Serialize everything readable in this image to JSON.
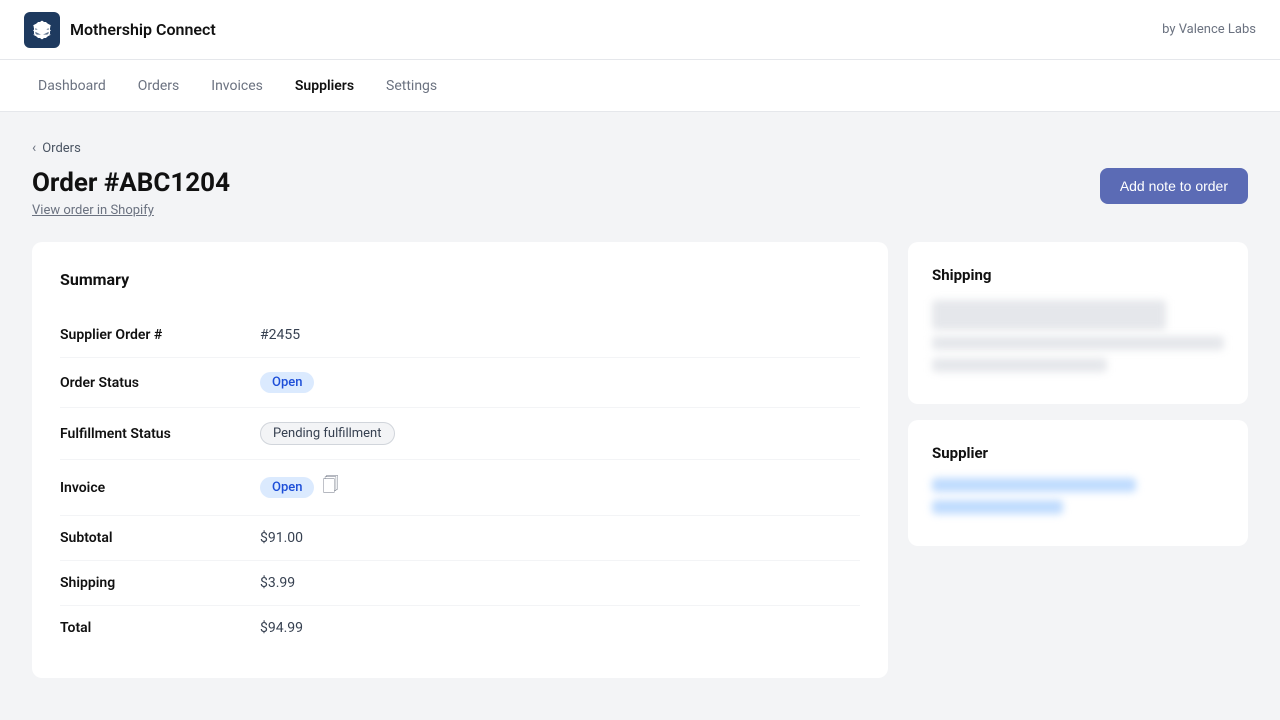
{
  "header": {
    "app_title": "Mothership Connect",
    "by_label": "by Valence Labs"
  },
  "nav": {
    "items": [
      {
        "label": "Dashboard",
        "active": false
      },
      {
        "label": "Orders",
        "active": false
      },
      {
        "label": "Invoices",
        "active": false
      },
      {
        "label": "Suppliers",
        "active": true
      },
      {
        "label": "Settings",
        "active": false
      }
    ]
  },
  "breadcrumb": {
    "back_label": "Orders"
  },
  "page": {
    "title": "Order #ABC1204",
    "shopify_link": "View order in Shopify",
    "add_note_btn": "Add note to order"
  },
  "summary": {
    "section_title": "Summary",
    "rows": [
      {
        "label": "Supplier Order #",
        "value": "#2455",
        "type": "text"
      },
      {
        "label": "Order Status",
        "value": "Open",
        "type": "badge-open"
      },
      {
        "label": "Fulfillment Status",
        "value": "Pending fulfillment",
        "type": "badge-pending"
      },
      {
        "label": "Invoice",
        "value": "Open",
        "type": "badge-open-doc"
      },
      {
        "label": "Subtotal",
        "value": "$91.00",
        "type": "text"
      },
      {
        "label": "Shipping",
        "value": "$3.99",
        "type": "text"
      },
      {
        "label": "Total",
        "value": "$94.99",
        "type": "text"
      }
    ]
  },
  "shipping_card": {
    "title": "Shipping"
  },
  "supplier_card": {
    "title": "Supplier"
  }
}
